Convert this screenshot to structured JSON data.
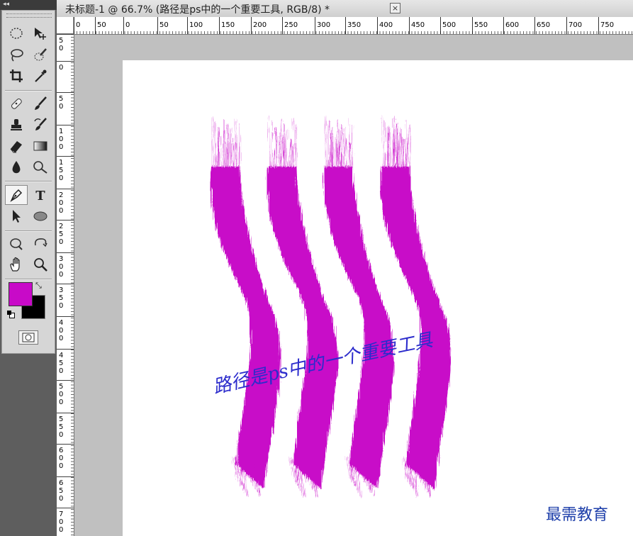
{
  "document": {
    "title": "未标题-1 @ 66.7% (路径是ps中的一个重要工具, RGB/8) *",
    "close_label": "×",
    "zoom": "66.7%",
    "color_mode": "RGB/8"
  },
  "ruler": {
    "horizontal_labels": [
      "0",
      "50",
      "0",
      "50",
      "100",
      "150",
      "200",
      "250",
      "300",
      "350",
      "400",
      "450",
      "500",
      "550",
      "600",
      "650",
      "700",
      "750"
    ],
    "vertical_labels": [
      [
        "5",
        "0"
      ],
      [
        "0"
      ],
      [
        "5",
        "0"
      ],
      [
        "1",
        "0",
        "0"
      ],
      [
        "1",
        "5",
        "0"
      ],
      [
        "2",
        "0",
        "0"
      ],
      [
        "2",
        "5",
        "0"
      ],
      [
        "3",
        "0",
        "0"
      ],
      [
        "3",
        "5",
        "0"
      ],
      [
        "4",
        "0",
        "0"
      ],
      [
        "4",
        "5",
        "0"
      ],
      [
        "5",
        "0",
        "0"
      ],
      [
        "5",
        "5",
        "0"
      ],
      [
        "6",
        "0",
        "0"
      ],
      [
        "6",
        "5",
        "0"
      ],
      [
        "7",
        "0",
        "0"
      ]
    ]
  },
  "canvas": {
    "text_on_path": "路径是ps中的一个重要工具",
    "stroke_color": "#c80ac8"
  },
  "toolbox": {
    "collapse_label": "◂◂",
    "tools": [
      "marquee-tool",
      "move-tool",
      "lasso-tool",
      "quick-selection-tool",
      "crop-tool",
      "eyedropper-tool",
      "healing-brush-tool",
      "brush-tool",
      "clone-stamp-tool",
      "history-brush-tool",
      "eraser-tool",
      "gradient-tool",
      "blur-tool",
      "dodge-tool",
      "pen-tool",
      "type-tool",
      "path-selection-tool",
      "ellipse-tool",
      "3d-rotate-tool",
      "3d-orbit-tool",
      "hand-tool",
      "zoom-tool"
    ],
    "active_tool": "pen-tool",
    "foreground_color": "#c80ac8",
    "background_color": "#000000"
  },
  "watermark": "最需教育"
}
